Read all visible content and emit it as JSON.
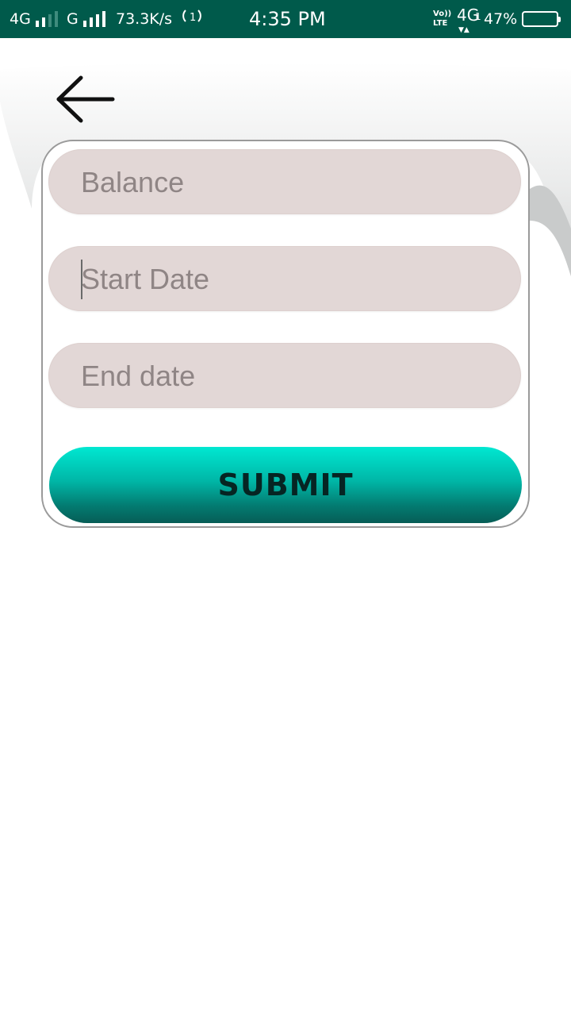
{
  "status_bar": {
    "network1": "4G",
    "network2": "G",
    "speed": "73.3K/s",
    "time": "4:35 PM",
    "volte": "Vo))",
    "lte": "LTE",
    "network3": "4G",
    "sim_index": "1",
    "battery_percent": "47%",
    "battery_level": 0.47
  },
  "nav": {
    "back_icon": "arrow-left-icon"
  },
  "form": {
    "balance_placeholder": "Balance",
    "start_date_placeholder": "Start Date",
    "end_date_placeholder": "End date",
    "submit_label": "SUBMIT"
  },
  "colors": {
    "status_bar_bg": "#005a4b",
    "field_bg": "#e2d7d6",
    "button_gradient_top": "#00e8d2",
    "button_gradient_bottom": "#065d56",
    "card_border": "#9a9a9a"
  }
}
